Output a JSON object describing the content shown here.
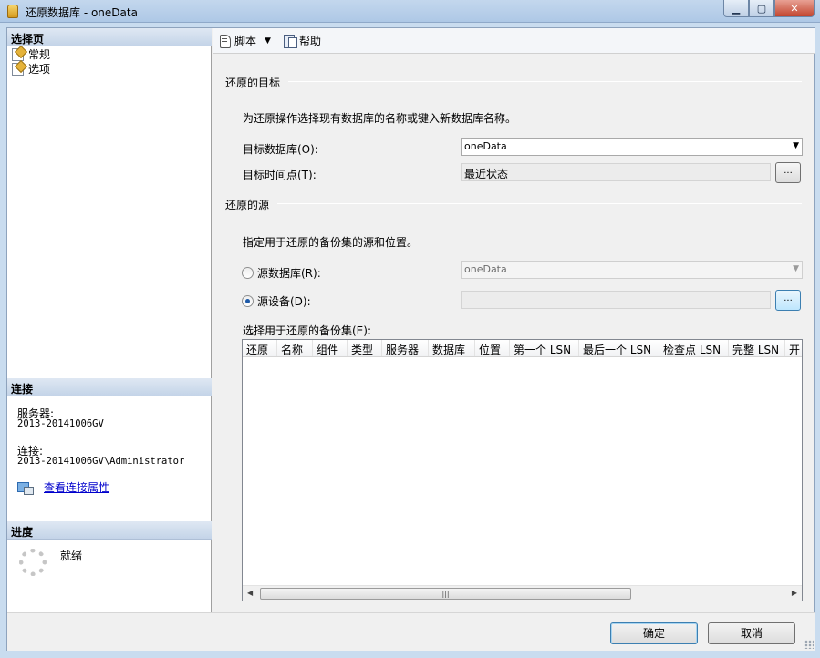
{
  "window": {
    "title": "还原数据库 - oneData"
  },
  "left": {
    "pages_header": "选择页",
    "pages": [
      "常规",
      "选项"
    ],
    "connection_header": "连接",
    "server_label": "服务器:",
    "server_value": "2013-20141006GV",
    "connect_label": "连接:",
    "connect_value": "2013-20141006GV\\Administrator",
    "view_props_link": "查看连接属性",
    "progress_header": "进度",
    "progress_status": "就绪"
  },
  "toolbar": {
    "script_label": "脚本",
    "help_label": "帮助"
  },
  "target": {
    "group_title": "还原的目标",
    "instruction": "为还原操作选择现有数据库的名称或键入新数据库名称。",
    "db_label": "目标数据库(O):",
    "db_value": "oneData",
    "time_label": "目标时间点(T):",
    "time_value": "最近状态",
    "browse_label": "..."
  },
  "source": {
    "group_title": "还原的源",
    "instruction": "指定用于还原的备份集的源和位置。",
    "from_db_label": "源数据库(R):",
    "from_db_value": "oneData",
    "from_device_label": "源设备(D):",
    "from_device_value": "",
    "browse_label": "...",
    "selected": "device",
    "backupsets_label": "选择用于还原的备份集(E):",
    "columns": [
      "还原",
      "名称",
      "组件",
      "类型",
      "服务器",
      "数据库",
      "位置",
      "第一个 LSN",
      "最后一个 LSN",
      "检查点 LSN",
      "完整 LSN",
      "开"
    ]
  },
  "buttons": {
    "ok": "确定",
    "cancel": "取消"
  }
}
